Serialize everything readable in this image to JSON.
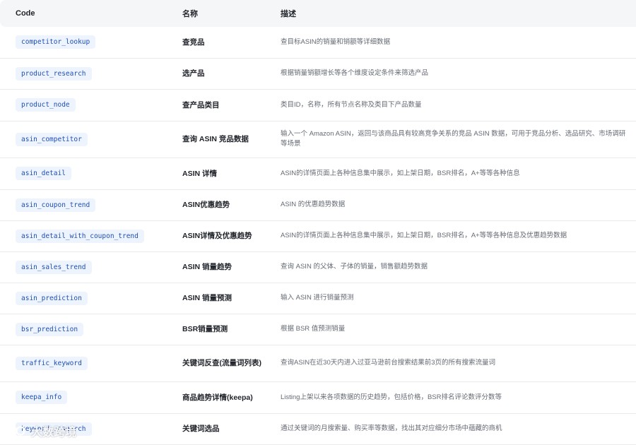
{
  "table": {
    "headers": {
      "code": "Code",
      "name": "名称",
      "desc": "描述"
    },
    "rows": [
      {
        "code": "competitor_lookup",
        "name": "查竞品",
        "desc": "查目标ASIN的销量和销额等详细数据"
      },
      {
        "code": "product_research",
        "name": "选产品",
        "desc": "根据销量销额增长等各个维度设定条件来筛选产品"
      },
      {
        "code": "product_node",
        "name": "查产品类目",
        "desc": "类目ID，名称，所有节点名称及类目下产品数量"
      },
      {
        "code": "asin_competitor",
        "name": "查询 ASIN 竞品数据",
        "desc": "输入一个 Amazon ASIN，返回与该商品具有较高竞争关系的竞品 ASIN 数据，可用于竞品分析、选品研究、市场调研等场景"
      },
      {
        "code": "asin_detail",
        "name": "ASIN 详情",
        "desc": "ASIN的详情页面上各种信息集中展示，如上架日期，BSR排名，A+等等各种信息"
      },
      {
        "code": "asin_coupon_trend",
        "name": "ASIN优惠趋势",
        "desc": "ASIN 的优惠趋势数据"
      },
      {
        "code": "asin_detail_with_coupon_trend",
        "name": "ASIN详情及优惠趋势",
        "desc": "ASIN的详情页面上各种信息集中展示，如上架日期，BSR排名，A+等等各种信息及优惠趋势数据"
      },
      {
        "code": "asin_sales_trend",
        "name": "ASIN 销量趋势",
        "desc": "查询 ASIN 的父体、子体的销量，销售额趋势数据"
      },
      {
        "code": "asin_prediction",
        "name": "ASIN 销量预测",
        "desc": "输入 ASIN 进行销量预测"
      },
      {
        "code": "bsr_prediction",
        "name": "BSR销量预测",
        "desc": "根据 BSR 值预测销量"
      },
      {
        "code": "traffic_keyword",
        "name": "关键词反查(流量词列表)",
        "desc": "查询ASIN在近30天内进入过亚马逊前台搜索结果前3页的所有搜索流量词"
      },
      {
        "code": "keepa_info",
        "name": "商品趋势详情(keepa)",
        "desc": "Listing上架以来各项数据的历史趋势，包括价格，BSR排名评论数评分数等"
      },
      {
        "code": "keyword_research",
        "name": "关键词选品",
        "desc": "通过关键词的月搜索量、购买率等数据，找出其对应细分市场中蕴藏的商机"
      }
    ]
  },
  "watermark": {
    "text": "大数跨境"
  }
}
